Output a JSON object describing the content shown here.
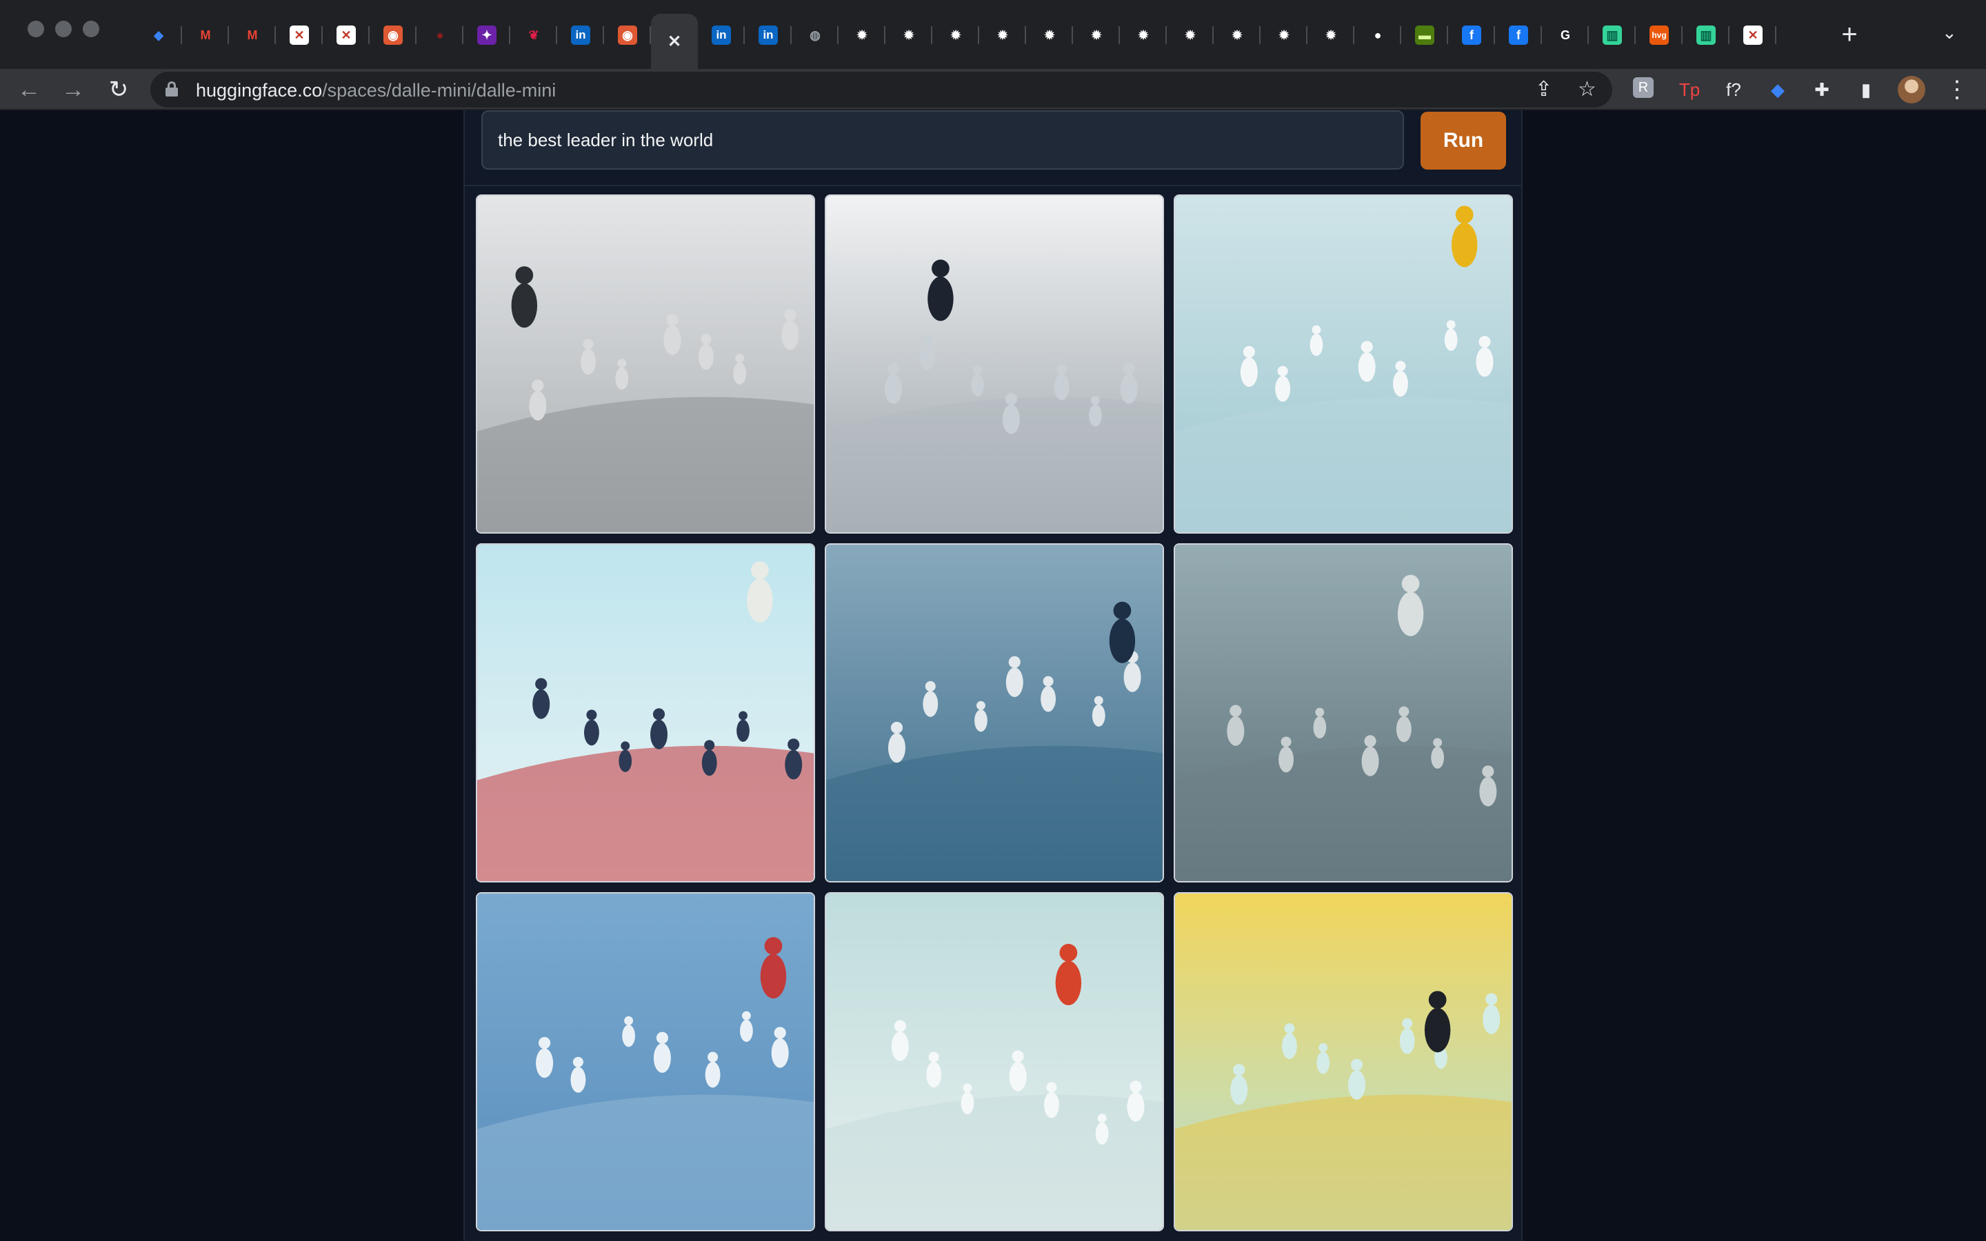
{
  "colors": {
    "page_background": "#0b0f19",
    "panel_background": "#111827",
    "run_button": "#c2651a"
  },
  "browser": {
    "tabs": [
      {
        "icon": "sapphire-gem-icon",
        "bg": "#202124",
        "color": "#3b82f6",
        "glyph": "◆"
      },
      {
        "icon": "gmail-icon",
        "bg": "#202124",
        "color": "#ea4335",
        "glyph": "M"
      },
      {
        "icon": "gmail-icon",
        "bg": "#202124",
        "color": "#ea4335",
        "glyph": "M"
      },
      {
        "icon": "stroke-app-icon",
        "bg": "#ffffff",
        "color": "#c0392b",
        "glyph": "✕"
      },
      {
        "icon": "stroke-app-icon",
        "bg": "#ffffff",
        "color": "#c0392b",
        "glyph": "✕"
      },
      {
        "icon": "duckduckgo-icon",
        "bg": "#de5833",
        "color": "#ffffff",
        "glyph": "◉"
      },
      {
        "icon": "red-dot-icon",
        "bg": "#202124",
        "color": "#8b1e1e",
        "glyph": "●"
      },
      {
        "icon": "purple-pin-icon",
        "bg": "#6b21a8",
        "color": "#ffffff",
        "glyph": "✦"
      },
      {
        "icon": "red-bird-icon",
        "bg": "#202124",
        "color": "#e11d48",
        "glyph": "❦"
      },
      {
        "icon": "linkedin-icon",
        "bg": "#0a66c2",
        "color": "#ffffff",
        "glyph": "in"
      },
      {
        "icon": "duckduckgo-icon",
        "bg": "#de5833",
        "color": "#ffffff",
        "glyph": "◉"
      },
      {
        "icon": "close-tab-icon",
        "bg": "#35363a",
        "color": "#e8eaed",
        "glyph": "✕",
        "active": true
      },
      {
        "icon": "linkedin-icon",
        "bg": "#0a66c2",
        "color": "#ffffff",
        "glyph": "in"
      },
      {
        "icon": "linkedin-icon",
        "bg": "#0a66c2",
        "color": "#ffffff",
        "glyph": "in"
      },
      {
        "icon": "globe-icon",
        "bg": "#202124",
        "color": "#9aa0a6",
        "glyph": "◍"
      },
      {
        "icon": "gear-icon",
        "bg": "#202124",
        "color": "#ffffff",
        "glyph": "✹"
      },
      {
        "icon": "gear-icon",
        "bg": "#202124",
        "color": "#ffffff",
        "glyph": "✹"
      },
      {
        "icon": "gear-icon",
        "bg": "#202124",
        "color": "#ffffff",
        "glyph": "✹"
      },
      {
        "icon": "gear-icon",
        "bg": "#202124",
        "color": "#ffffff",
        "glyph": "✹"
      },
      {
        "icon": "gear-icon",
        "bg": "#202124",
        "color": "#ffffff",
        "glyph": "✹"
      },
      {
        "icon": "gear-icon",
        "bg": "#202124",
        "color": "#ffffff",
        "glyph": "✹"
      },
      {
        "icon": "gear-icon",
        "bg": "#202124",
        "color": "#ffffff",
        "glyph": "✹"
      },
      {
        "icon": "gear-icon",
        "bg": "#202124",
        "color": "#ffffff",
        "glyph": "✹"
      },
      {
        "icon": "gear-icon",
        "bg": "#202124",
        "color": "#ffffff",
        "glyph": "✹"
      },
      {
        "icon": "gear-icon",
        "bg": "#202124",
        "color": "#ffffff",
        "glyph": "✹"
      },
      {
        "icon": "gear-icon",
        "bg": "#202124",
        "color": "#ffffff",
        "glyph": "✹"
      },
      {
        "icon": "github-icon",
        "bg": "#202124",
        "color": "#ffffff",
        "glyph": "●"
      },
      {
        "icon": "green-card-icon",
        "bg": "#4d7c0f",
        "color": "#d9f99d",
        "glyph": "▬"
      },
      {
        "icon": "facebook-icon",
        "bg": "#1877f2",
        "color": "#ffffff",
        "glyph": "f"
      },
      {
        "icon": "facebook-icon",
        "bg": "#1877f2",
        "color": "#ffffff",
        "glyph": "f"
      },
      {
        "icon": "g-letter-icon",
        "bg": "#202124",
        "color": "#ffffff",
        "glyph": "G"
      },
      {
        "icon": "green-bars-icon",
        "bg": "#34d399",
        "color": "#065f46",
        "glyph": "▥"
      },
      {
        "icon": "hvg-icon",
        "bg": "#ea580c",
        "color": "#ffffff",
        "glyph": "hvg"
      },
      {
        "icon": "green-bars-icon",
        "bg": "#34d399",
        "color": "#065f46",
        "glyph": "▥"
      },
      {
        "icon": "stroke-app-icon",
        "bg": "#ffffff",
        "color": "#c0392b",
        "glyph": "✕"
      }
    ],
    "address_host": "huggingface.co",
    "address_path": "/spaces/dalle-mini/dalle-mini",
    "extensions": [
      {
        "icon": "grammarly-r-icon",
        "glyph": "R",
        "color": "#9ca3af"
      },
      {
        "icon": "tp-icon",
        "glyph": "Tp",
        "color": "#ef4444"
      },
      {
        "icon": "formula-icon",
        "glyph": "f?",
        "color": "#e8eaed"
      },
      {
        "icon": "sapphire-gem-icon",
        "glyph": "◆",
        "color": "#3b82f6"
      },
      {
        "icon": "puzzle-extensions-icon",
        "glyph": "✚",
        "color": "#e8eaed"
      },
      {
        "icon": "side-panel-icon",
        "glyph": "▮",
        "color": "#e8eaed"
      }
    ]
  },
  "app": {
    "prompt_value": "the best leader in the world",
    "run_label": "Run",
    "images": [
      {
        "name": "generated-image-1",
        "bg1": "#e4e6e8",
        "bg2": "#a9adb0",
        "leader": "#2b2f33",
        "crowd": "#d9dadb",
        "floor": "#8e9296"
      },
      {
        "name": "generated-image-2",
        "bg1": "#f1f2f3",
        "bg2": "#9aa3aa",
        "leader": "#1d2430",
        "crowd": "#c9d0d5",
        "floor": "#b5bcc1"
      },
      {
        "name": "generated-image-3",
        "bg1": "#cfe4e8",
        "bg2": "#9ec7d0",
        "leader": "#e8b419",
        "crowd": "#f4f7f8",
        "floor": "#b8d6dc"
      },
      {
        "name": "generated-image-4",
        "bg1": "#bfe5ee",
        "bg2": "#e7f3f4",
        "leader": "#e9ebe7",
        "crowd": "#2c3a55",
        "floor": "#c4353a"
      },
      {
        "name": "generated-image-5",
        "bg1": "#88a9bd",
        "bg2": "#3e6d8b",
        "leader": "#1d2f44",
        "crowd": "#e3e9ec",
        "floor": "#3b6a86"
      },
      {
        "name": "generated-image-6",
        "bg1": "#96acb3",
        "bg2": "#5d7077",
        "leader": "#d9dedf",
        "crowd": "#c8cfd1",
        "floor": "#6f8288"
      },
      {
        "name": "generated-image-7",
        "bg1": "#79a9cf",
        "bg2": "#5a8fbd",
        "leader": "#c23a3a",
        "crowd": "#eaf1f6",
        "floor": "#8fb7d6"
      },
      {
        "name": "generated-image-8",
        "bg1": "#bfdcdc",
        "bg2": "#e6efee",
        "leader": "#d6442b",
        "crowd": "#f4f8f8",
        "floor": "#c9dcdc"
      },
      {
        "name": "generated-image-9",
        "bg1": "#f1d55c",
        "bg2": "#b7e0d6",
        "leader": "#1e2228",
        "crowd": "#d4ece7",
        "floor": "#e8c548"
      }
    ]
  }
}
